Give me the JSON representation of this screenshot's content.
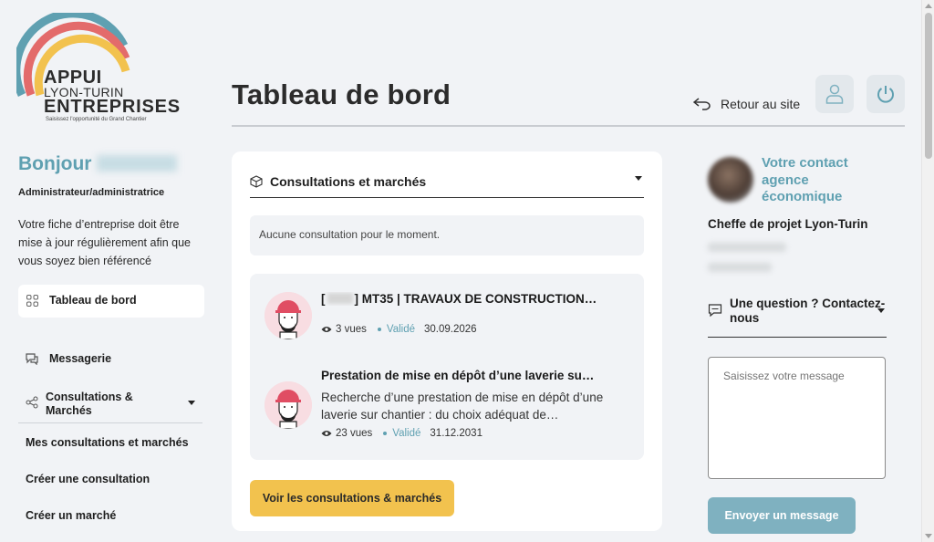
{
  "logo": {
    "line1": "APPUI",
    "line2": "LYON-TURIN",
    "line3": "ENTREPRISES",
    "tagline": "Saisissez l'opportunité du Grand Chantier"
  },
  "sidebar": {
    "greeting": "Bonjour",
    "role": "Administrateur/administratrice",
    "notice": "Votre fiche d’entreprise doit être mise à jour régulièrement afin que vous soyez bien référencé",
    "items": [
      {
        "label": "Tableau de bord",
        "icon": "grid-icon"
      },
      {
        "label": "Messagerie",
        "icon": "chat-icon"
      },
      {
        "label": "Consultations & Marchés",
        "icon": "share-icon"
      }
    ],
    "subitems": [
      "Mes consultations et marchés",
      "Créer une consultation",
      "Créer un marché"
    ]
  },
  "header": {
    "title": "Tableau de bord",
    "back_label": "Retour au site"
  },
  "main": {
    "section_title": "Consultations et marchés",
    "empty_text": "Aucune consultation pour le moment.",
    "items": [
      {
        "title_prefix": "[",
        "title": "] MT35 | TRAVAUX DE CONSTRUCTION…",
        "views": "3 vues",
        "status": "Validé",
        "date": "30.09.2026"
      },
      {
        "title": "Prestation de mise en dépôt d’une laverie su…",
        "description": "Recherche d’une prestation de mise en dépôt d’une laverie sur chantier : du choix adéquat de…",
        "views": "23 vues",
        "status": "Validé",
        "date": "31.12.2031"
      }
    ],
    "cta_label": "Voir les consultations & marchés"
  },
  "contact": {
    "title": "Votre contact agence économique",
    "role": "Cheffe de projet Lyon-Turin",
    "question_label": "Une question ? Contactez-nous",
    "message_placeholder": "Saisissez votre message",
    "send_label": "Envoyer un message"
  },
  "colors": {
    "accent": "#5fa0b1",
    "cta": "#f2c24e",
    "send": "#7fb1c0",
    "background": "#f1f3f6"
  }
}
